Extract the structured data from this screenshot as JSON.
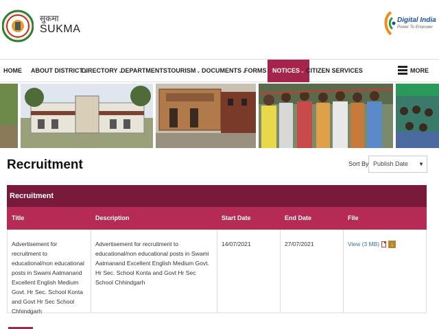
{
  "header": {
    "site_hindi": "सुकमा",
    "site_name": "SUKMA",
    "digital_india": "Digital India",
    "digital_india_tagline": "Power To Empower"
  },
  "nav": {
    "items": [
      {
        "label": "HOME",
        "dropdown": false
      },
      {
        "label": "ABOUT DISTRICT",
        "dropdown": true
      },
      {
        "label": "DIRECTORY",
        "dropdown": true
      },
      {
        "label": "DEPARTMENTS",
        "dropdown": true
      },
      {
        "label": "TOURISM",
        "dropdown": true
      },
      {
        "label": "DOCUMENTS",
        "dropdown": true
      },
      {
        "label": "FORMS",
        "dropdown": false
      },
      {
        "label": "NOTICES",
        "dropdown": true,
        "active": true
      },
      {
        "label": "CITIZEN SERVICES",
        "dropdown": false
      }
    ],
    "more_label": "MORE",
    "dropdown_caret": "⌄"
  },
  "page": {
    "title": "Recruitment",
    "sort_label": "Sort By:",
    "sort_value": "Publish Date"
  },
  "table": {
    "caption": "Recruitment",
    "headers": [
      "Title",
      "Description",
      "Start Date",
      "End Date",
      "File"
    ],
    "rows": [
      {
        "title": "Advertisement for recruitment to educational/non educational posts in Swami Aatmanand Excellent English Medium Govt. Hr Sec. School Konta and Govt Hr Sec School Chhindgarh",
        "description": "Advertisement for recruitment to educational/non educational posts in Swami Aatmanand Excellent English Medium Govt. Hr Sec. School Konta and Govt Hr Sec School Chhindgarh",
        "start_date": "14/07/2021",
        "end_date": "27/07/2021",
        "file_link": "View (3 MB)"
      }
    ]
  },
  "colors": {
    "nav_active": "#a4244b",
    "table_caption": "#7a1a3a",
    "table_header": "#b62b56",
    "link": "#3a6fb0"
  },
  "icons": [
    "district-emblem-icon",
    "digital-india-logo-icon",
    "chevron-down-icon",
    "hamburger-menu-icon",
    "pdf-icon",
    "download-icon"
  ]
}
